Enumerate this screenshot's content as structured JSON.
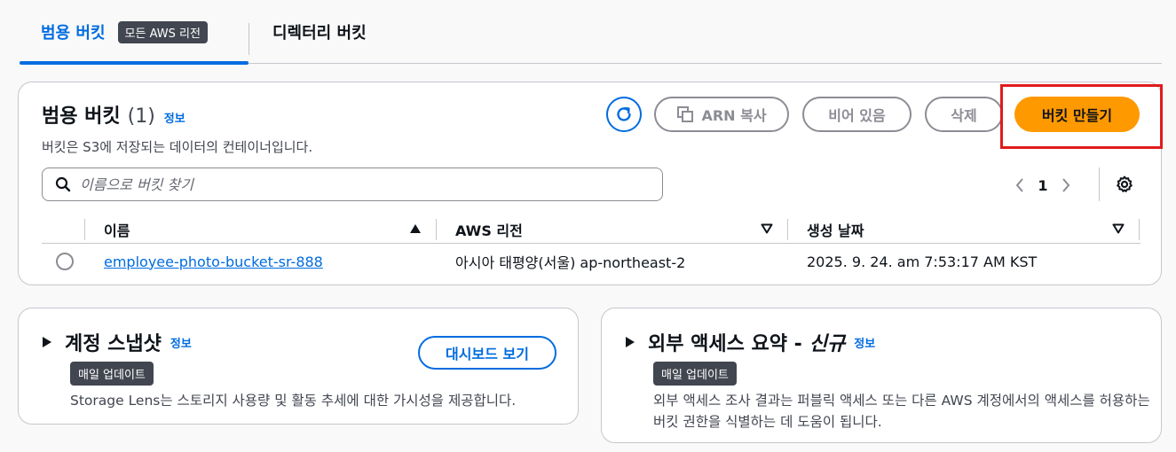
{
  "tabs": {
    "general": "범용 버킷",
    "general_badge": "모든 AWS 리전",
    "directory": "디렉터리 버킷"
  },
  "buckets_panel": {
    "title": "범용 버킷",
    "count": "(1)",
    "info": "정보",
    "description": "버킷은 S3에 저장되는 데이터의 컨테이너입니다.",
    "buttons": {
      "copy_arn": "ARN 복사",
      "empty": "비어 있음",
      "delete": "삭제",
      "create": "버킷 만들기"
    },
    "search_placeholder": "이름으로 버킷 찾기",
    "page_number": "1",
    "columns": {
      "name": "이름",
      "region": "AWS 리전",
      "created": "생성 날짜"
    },
    "rows": [
      {
        "name": "employee-photo-bucket-sr-888",
        "region": "아시아 태평양(서울) ap-northeast-2",
        "created": "2025. 9. 24. am 7:53:17 AM KST"
      }
    ]
  },
  "snapshot_panel": {
    "title": "계정 스냅샷",
    "info": "정보",
    "badge": "매일 업데이트",
    "dashboard_button": "대시보드 보기",
    "description": "Storage Lens는 스토리지 사용량 및 활동 추세에 대한 가시성을 제공합니다."
  },
  "external_panel": {
    "title": "외부 액세스 요약 -",
    "title_new": "신규",
    "info": "정보",
    "badge": "매일 업데이트",
    "description": "외부 액세스 조사 결과는 퍼블릭 액세스 또는 다른 AWS 계정에서의 액세스를 허용하는 버킷 권한을 식별하는 데 도움이 됩니다."
  },
  "colors": {
    "link": "#006ce0",
    "primary_button": "#ff9900",
    "highlight_box": "#e01b1b",
    "badge_bg": "#424650"
  },
  "icons": [
    "refresh-icon",
    "copy-icon",
    "search-icon",
    "chevron-left-icon",
    "chevron-right-icon",
    "settings-icon",
    "sort-ascending-icon",
    "sort-descending-icon",
    "caret-right-icon"
  ]
}
